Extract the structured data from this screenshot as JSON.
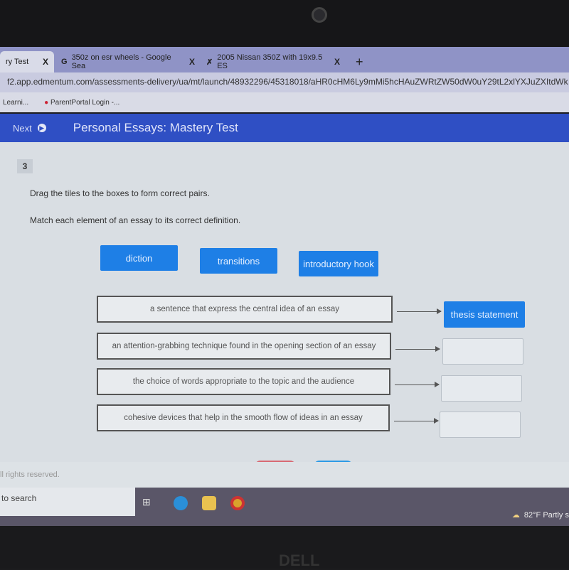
{
  "browser": {
    "tabs": [
      {
        "label": "ry Test",
        "active": true
      },
      {
        "label": "350z on esr wheels - Google Sea",
        "icon": "google-icon"
      },
      {
        "label": "2005 Nissan 350Z with 19x9.5 ES"
      }
    ],
    "new_tab": "+",
    "close": "X",
    "url": "f2.app.edmentum.com/assessments-delivery/ua/mt/launch/48932296/45318018/aHR0cHM6Ly9mMi5hcHAuZWRtZW50dW0uY29tL2xlYXJuZXItdWk",
    "bookmarks": [
      "Learni...",
      "ParentPortal Login -..."
    ]
  },
  "header": {
    "next_label": "Next",
    "title": "Personal Essays: Mastery Test",
    "color": "#2f4fc4"
  },
  "question": {
    "number": "3",
    "instruction1": "Drag the tiles to the boxes to form correct pairs.",
    "instruction2": "Match each element of an essay to its correct definition.",
    "tiles": [
      "diction",
      "transitions",
      "introductory hook"
    ],
    "pairs": [
      {
        "definition": "a sentence that express the central idea of an essay",
        "answer": "thesis statement"
      },
      {
        "definition": "an attention-grabbing technique found in the opening section of an essay",
        "answer": ""
      },
      {
        "definition": "the choice of words appropriate to the topic and the audience",
        "answer": ""
      },
      {
        "definition": "cohesive devices that help in the smooth flow of ideas in an essay",
        "answer": ""
      }
    ],
    "tile_color": "#1e7fe6"
  },
  "footer": {
    "text": "ll rights reserved."
  },
  "taskbar": {
    "search": "to search",
    "weather": "82°F  Partly s"
  },
  "brand": "DELL"
}
